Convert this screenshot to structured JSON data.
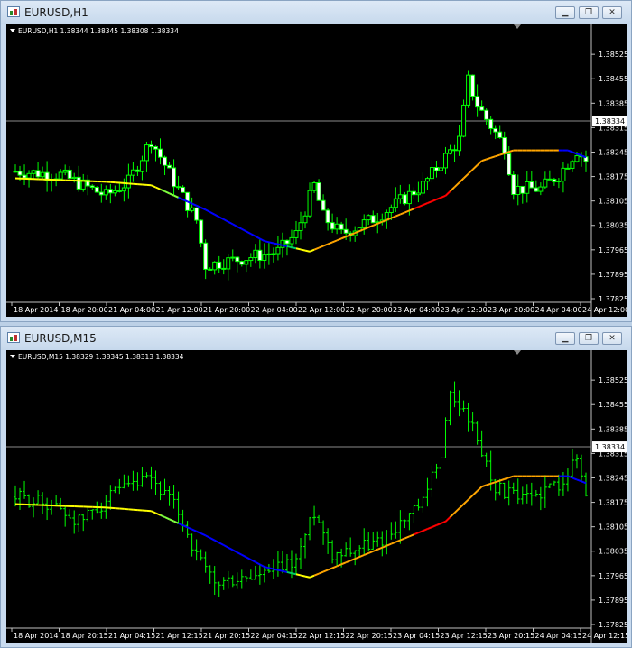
{
  "windows": [
    {
      "title": "EURUSD,H1",
      "info": "EURUSD,H1  1.38344 1.38345 1.38308 1.38334",
      "current_price": "1.38334",
      "controls": [
        "▁",
        "❐",
        "✕"
      ],
      "chart_data": {
        "type": "candlestick",
        "title": "EURUSD,H1",
        "ylim": [
          1.37825,
          1.3859
        ],
        "yticks": [
          "1.38525",
          "1.38455",
          "1.38385",
          "1.38315",
          "1.38245",
          "1.38175",
          "1.38105",
          "1.38035",
          "1.37965",
          "1.37895",
          "1.37825"
        ],
        "xticks": [
          "18 Apr 2014",
          "18 Apr 20:00",
          "21 Apr 04:00",
          "21 Apr 12:00",
          "21 Apr 20:00",
          "22 Apr 04:00",
          "22 Apr 12:00",
          "22 Apr 20:00",
          "23 Apr 04:00",
          "23 Apr 12:00",
          "23 Apr 20:00",
          "24 Apr 04:00",
          "24 Apr 12:00"
        ],
        "anchors": [
          [
            0,
            1.3819
          ],
          [
            10,
            1.3818
          ],
          [
            20,
            1.3812
          ],
          [
            25,
            1.3816
          ],
          [
            30,
            1.3828
          ],
          [
            35,
            1.3816
          ],
          [
            40,
            1.3805
          ],
          [
            42,
            1.3792
          ],
          [
            50,
            1.3794
          ],
          [
            58,
            1.3796
          ],
          [
            62,
            1.3801
          ],
          [
            66,
            1.3815
          ],
          [
            68,
            1.3806
          ],
          [
            72,
            1.3801
          ],
          [
            80,
            1.3806
          ],
          [
            90,
            1.3815
          ],
          [
            98,
            1.3828
          ],
          [
            100,
            1.3845
          ],
          [
            102,
            1.3838
          ],
          [
            108,
            1.3826
          ],
          [
            110,
            1.3814
          ],
          [
            116,
            1.3814
          ],
          [
            120,
            1.3818
          ],
          [
            124,
            1.3825
          ],
          [
            126,
            1.3822
          ]
        ],
        "ma": [
          [
            0,
            1.3817
          ],
          [
            20,
            1.3816
          ],
          [
            30,
            1.3815
          ],
          [
            42,
            1.3808
          ],
          [
            55,
            1.3799
          ],
          [
            65,
            1.3796
          ],
          [
            80,
            1.3804
          ],
          [
            95,
            1.3812
          ],
          [
            103,
            1.3822
          ],
          [
            110,
            1.3825
          ],
          [
            122,
            1.3825
          ],
          [
            126,
            1.3823
          ]
        ],
        "current": 1.38334
      }
    },
    {
      "title": "EURUSD,M15",
      "info": "EURUSD,M15  1.38329 1.38345 1.38313 1.38334",
      "current_price": "1.38334",
      "controls": [
        "▁",
        "❐",
        "✕"
      ],
      "chart_data": {
        "type": "bar",
        "title": "EURUSD,M15",
        "ylim": [
          1.37825,
          1.3859
        ],
        "yticks": [
          "1.38525",
          "1.38455",
          "1.38385",
          "1.38315",
          "1.38245",
          "1.38175",
          "1.38105",
          "1.38035",
          "1.37965",
          "1.37895",
          "1.37825"
        ],
        "xticks": [
          "18 Apr 2014",
          "18 Apr 20:15",
          "21 Apr 04:15",
          "21 Apr 12:15",
          "21 Apr 20:15",
          "22 Apr 04:15",
          "22 Apr 12:15",
          "22 Apr 20:15",
          "23 Apr 04:15",
          "23 Apr 12:15",
          "23 Apr 20:15",
          "24 Apr 04:15",
          "24 Apr 12:15"
        ],
        "anchors": [
          [
            0,
            1.3819
          ],
          [
            8,
            1.3817
          ],
          [
            14,
            1.3812
          ],
          [
            22,
            1.382
          ],
          [
            30,
            1.3824
          ],
          [
            36,
            1.3815
          ],
          [
            40,
            1.3802
          ],
          [
            44,
            1.3794
          ],
          [
            56,
            1.3797
          ],
          [
            62,
            1.3801
          ],
          [
            66,
            1.3815
          ],
          [
            70,
            1.3803
          ],
          [
            80,
            1.3806
          ],
          [
            90,
            1.3817
          ],
          [
            94,
            1.3832
          ],
          [
            96,
            1.3848
          ],
          [
            100,
            1.3842
          ],
          [
            106,
            1.3822
          ],
          [
            112,
            1.3818
          ],
          [
            120,
            1.3823
          ],
          [
            124,
            1.383
          ],
          [
            126,
            1.382
          ]
        ],
        "ma": [
          [
            0,
            1.3817
          ],
          [
            20,
            1.3816
          ],
          [
            30,
            1.3815
          ],
          [
            42,
            1.3808
          ],
          [
            55,
            1.3799
          ],
          [
            65,
            1.3796
          ],
          [
            80,
            1.3804
          ],
          [
            95,
            1.3812
          ],
          [
            103,
            1.3822
          ],
          [
            110,
            1.3825
          ],
          [
            122,
            1.3825
          ],
          [
            126,
            1.3823
          ]
        ],
        "current": 1.38334
      }
    }
  ]
}
